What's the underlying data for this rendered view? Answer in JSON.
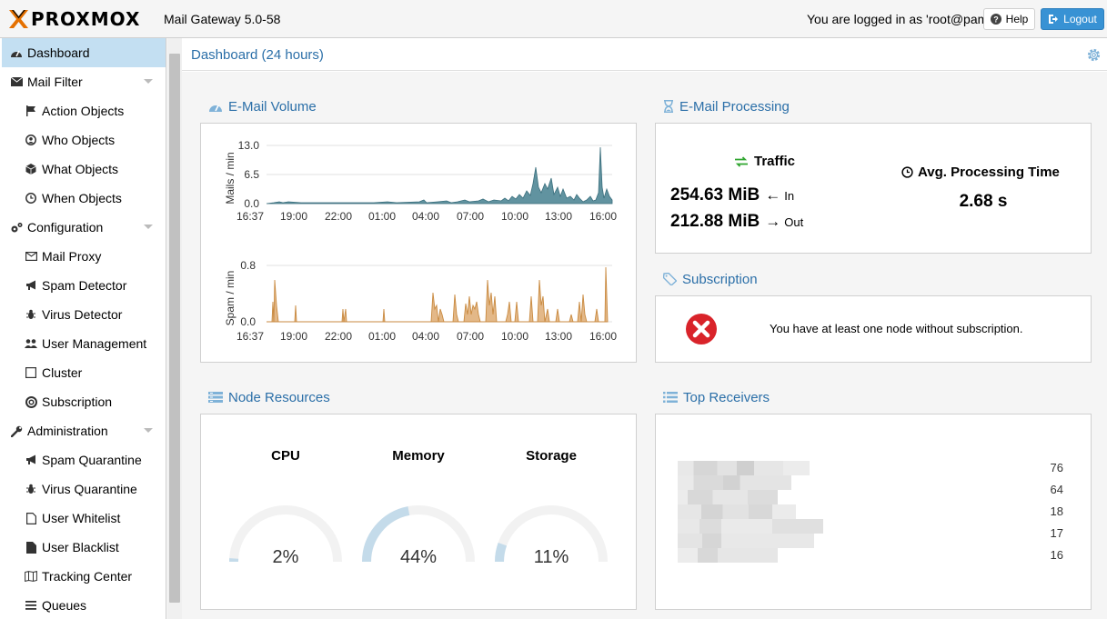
{
  "header": {
    "logo_text": "PROXMOX",
    "version": "Mail Gateway 5.0-58",
    "login_text": "You are logged in as 'root@pam'",
    "help_label": "Help",
    "logout_label": "Logout"
  },
  "sidebar": {
    "items": [
      {
        "label": "Dashboard",
        "icon": "dashboard-icon"
      },
      {
        "label": "Mail Filter",
        "icon": "envelope-icon"
      },
      {
        "label": "Action Objects",
        "icon": "flag-icon"
      },
      {
        "label": "Who Objects",
        "icon": "user-icon"
      },
      {
        "label": "What Objects",
        "icon": "cube-icon"
      },
      {
        "label": "When Objects",
        "icon": "clock-icon"
      },
      {
        "label": "Configuration",
        "icon": "gears-icon"
      },
      {
        "label": "Mail Proxy",
        "icon": "envelope-outline-icon"
      },
      {
        "label": "Spam Detector",
        "icon": "bullhorn-icon"
      },
      {
        "label": "Virus Detector",
        "icon": "bug-icon"
      },
      {
        "label": "User Management",
        "icon": "users-icon"
      },
      {
        "label": "Cluster",
        "icon": "server-icon"
      },
      {
        "label": "Subscription",
        "icon": "support-icon"
      },
      {
        "label": "Administration",
        "icon": "wrench-icon"
      },
      {
        "label": "Spam Quarantine",
        "icon": "bullhorn-icon"
      },
      {
        "label": "Virus Quarantine",
        "icon": "bug-icon"
      },
      {
        "label": "User Whitelist",
        "icon": "file-icon"
      },
      {
        "label": "User Blacklist",
        "icon": "file-dark-icon"
      },
      {
        "label": "Tracking Center",
        "icon": "map-icon"
      },
      {
        "label": "Queues",
        "icon": "bars-icon"
      }
    ]
  },
  "main": {
    "title": "Dashboard (24 hours)"
  },
  "email_volume": {
    "title": "E-Mail Volume",
    "mail_ylabel": "Mails / min",
    "spam_ylabel": "Spam / min",
    "mail_ticks": [
      "13.0",
      "6.5",
      "0.0"
    ],
    "spam_ticks": [
      "0.8",
      "0.0"
    ],
    "x_ticks": [
      "16:37",
      "19:00",
      "22:00",
      "01:00",
      "04:00",
      "07:00",
      "10:00",
      "13:00",
      "16:00"
    ]
  },
  "email_processing": {
    "title": "E-Mail Processing",
    "traffic_label": "Traffic",
    "in_value": "254.63 MiB",
    "in_arrow": "←",
    "in_label": "In",
    "out_value": "212.88 MiB",
    "out_arrow": "→",
    "out_label": "Out",
    "avg_label": "Avg. Processing Time",
    "avg_value": "2.68 s"
  },
  "subscription": {
    "title": "Subscription",
    "message": "You have at least one node without subscription."
  },
  "node_resources": {
    "title": "Node Resources",
    "gauges": [
      {
        "label": "CPU",
        "value": "2%",
        "fraction": 0.02
      },
      {
        "label": "Memory",
        "value": "44%",
        "fraction": 0.44
      },
      {
        "label": "Storage",
        "value": "11%",
        "fraction": 0.11
      }
    ]
  },
  "top_receivers": {
    "title": "Top Receivers",
    "counts": [
      "76",
      "64",
      "18",
      "17",
      "16"
    ]
  },
  "colors": {
    "accent": "#2b6fa8",
    "selected": "#c3dff2",
    "mail_series": "#45808f",
    "spam_series": "#d9a060",
    "gauge_fill": "#c4dbea",
    "logout": "#3892d4",
    "error": "#d9232a"
  }
}
